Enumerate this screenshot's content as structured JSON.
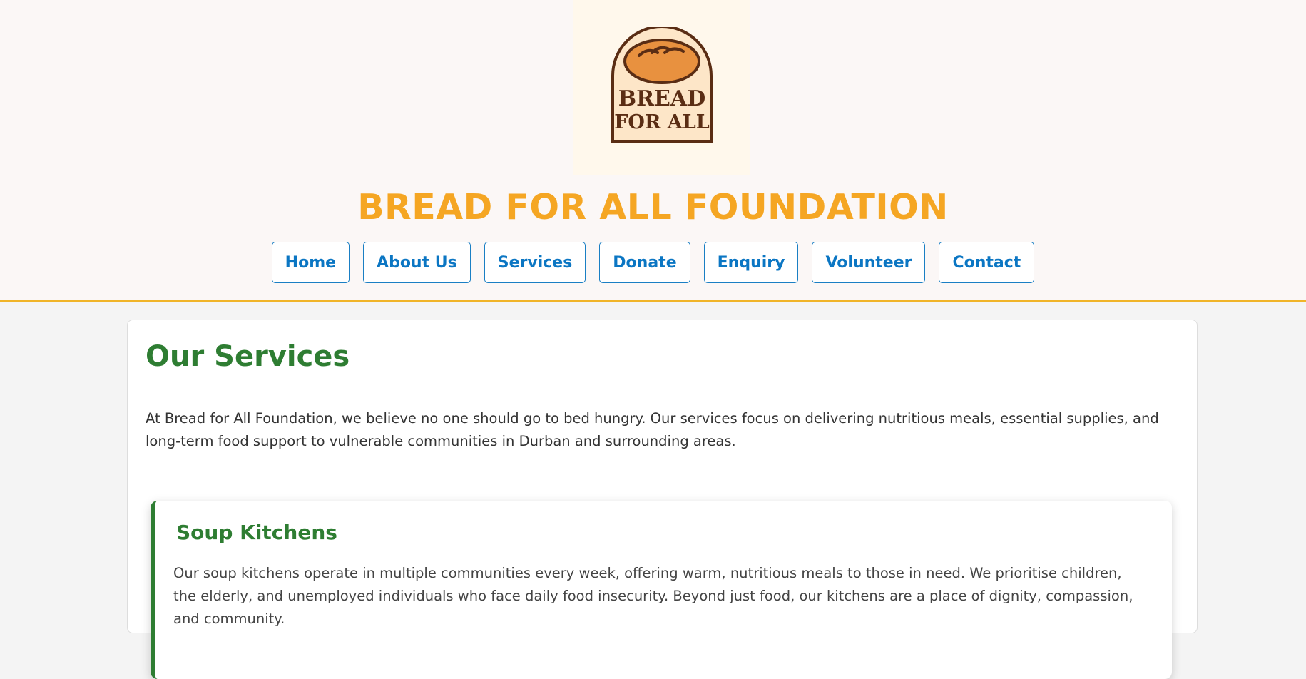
{
  "header": {
    "logo": {
      "line1": "BREAD",
      "line2": "FOR ALL"
    },
    "site_title": "BREAD FOR ALL FOUNDATION",
    "nav": [
      {
        "label": "Home"
      },
      {
        "label": "About Us"
      },
      {
        "label": "Services"
      },
      {
        "label": "Donate"
      },
      {
        "label": "Enquiry"
      },
      {
        "label": "Volunteer"
      },
      {
        "label": "Contact"
      }
    ]
  },
  "main": {
    "heading": "Our Services",
    "intro": "At Bread for All Foundation, we believe no one should go to bed hungry. Our services focus on delivering nutritious meals, essential supplies, and long-term food support to vulnerable communities in Durban and surrounding areas.",
    "services": [
      {
        "title": "Soup Kitchens",
        "description": "Our soup kitchens operate in multiple communities every week, offering warm, nutritious meals to those in need. We prioritise children, the elderly, and unemployed individuals who face daily food insecurity. Beyond just food, our kitchens are a place of dignity, compassion, and community."
      }
    ]
  },
  "colors": {
    "title_orange": "#f5a623",
    "nav_blue": "#0b76c3",
    "heading_green": "#2e7d32",
    "header_bg": "#fbf7f6",
    "header_border": "#f0b429"
  }
}
